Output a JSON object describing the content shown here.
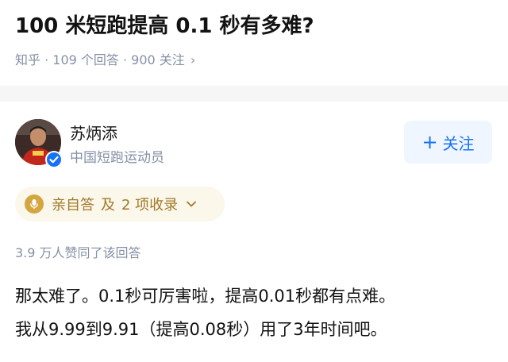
{
  "question": {
    "title": "100 米短跑提高 0.1 秒有多难?",
    "meta": "知乎 · 109 个回答 · 900 关注",
    "meta_chevron": "›"
  },
  "author": {
    "name": "苏炳添",
    "description": "中国短跑运动员",
    "follow_label": "关注",
    "follow_plus": "+",
    "verified_icon": "verified-badge-icon",
    "verified_color": "#1772f6"
  },
  "chip": {
    "self_answer_label": "亲自答",
    "separator": "及",
    "collections_label": "2 项收录",
    "icon": "microphone-icon",
    "accent_color": "#d3a640"
  },
  "answer": {
    "likes": "3.9 万人赞同了该回答",
    "lines": [
      "那太难了。0.1秒可厉害啦，提高0.01秒都有点难。",
      "我从9.99到9.91（提高0.08秒）用了3年时间吧。"
    ]
  },
  "colors": {
    "primary_blue": "#1772f6",
    "meta_gray": "#8590a6",
    "text": "#121212"
  }
}
